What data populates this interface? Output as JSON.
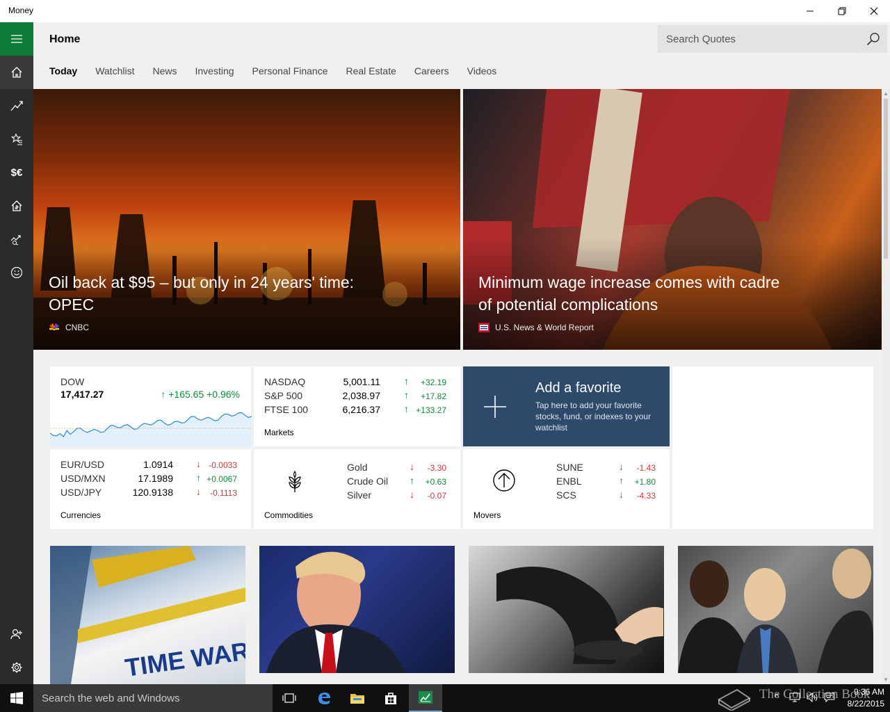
{
  "window": {
    "title": "Money"
  },
  "header": {
    "page_title": "Home",
    "search_placeholder": "Search Quotes",
    "tabs": [
      {
        "label": "Today",
        "active": true
      },
      {
        "label": "Watchlist"
      },
      {
        "label": "News"
      },
      {
        "label": "Investing"
      },
      {
        "label": "Personal Finance"
      },
      {
        "label": "Real Estate"
      },
      {
        "label": "Careers"
      },
      {
        "label": "Videos"
      }
    ]
  },
  "rail": {
    "items": [
      "hamburger-icon",
      "home-icon",
      "chart-icon",
      "watchlist-icon",
      "currency-icon",
      "real-estate-icon",
      "investing-icon",
      "smiley-icon",
      "account-icon",
      "settings-icon"
    ],
    "currency_glyph": "$€"
  },
  "heroes": [
    {
      "headline": "Oil back at $95 – but only in 24 years' time: OPEC",
      "source": "CNBC"
    },
    {
      "headline": "Minimum wage increase comes with cadre of potential complications",
      "source": "U.S. News & World Report"
    }
  ],
  "dow": {
    "name": "DOW",
    "value": "17,417.27",
    "change": "+165.65",
    "percent": "+0.96%"
  },
  "markets": {
    "label": "Markets",
    "rows": [
      {
        "name": "NASDAQ",
        "value": "5,001.11",
        "change": "+32.19",
        "dir": "up"
      },
      {
        "name": "S&P 500",
        "value": "2,038.97",
        "change": "+17.82",
        "dir": "up"
      },
      {
        "name": "FTSE 100",
        "value": "6,216.37",
        "change": "+133.27",
        "dir": "up"
      }
    ]
  },
  "favorite": {
    "title": "Add a favorite",
    "desc": "Tap here to add your favorite stocks, fund, or indexes to your watchlist"
  },
  "currencies": {
    "label": "Currencies",
    "rows": [
      {
        "name": "EUR/USD",
        "value": "1.0914",
        "change": "-0.0033",
        "dir": "down"
      },
      {
        "name": "USD/MXN",
        "value": "17.1989",
        "change": "+0.0067",
        "dir": "up"
      },
      {
        "name": "USD/JPY",
        "value": "120.9138",
        "change": "-0.1113",
        "dir": "down"
      }
    ]
  },
  "commodities": {
    "label": "Commodities",
    "rows": [
      {
        "name": "Gold",
        "change": "-3.30",
        "dir": "down"
      },
      {
        "name": "Crude Oil",
        "change": "+0.63",
        "dir": "up"
      },
      {
        "name": "Silver",
        "change": "-0.07",
        "dir": "down"
      }
    ]
  },
  "movers": {
    "label": "Movers",
    "rows": [
      {
        "name": "SUNE",
        "change": "-1.43",
        "dir": "down"
      },
      {
        "name": "ENBL",
        "change": "+1.80",
        "dir": "up"
      },
      {
        "name": "SCS",
        "change": "-4.33",
        "dir": "down"
      }
    ]
  },
  "thumb1_text": "TIME WARN",
  "taskbar": {
    "search_placeholder": "Search the web and Windows",
    "time": "9:36 AM",
    "date": "8/22/2015",
    "watermark": "The Collection Book"
  },
  "colors": {
    "accent": "#0f7b3a",
    "up": "#0f8a3a",
    "down": "#d13438",
    "favorite": "#2d4a6a"
  }
}
